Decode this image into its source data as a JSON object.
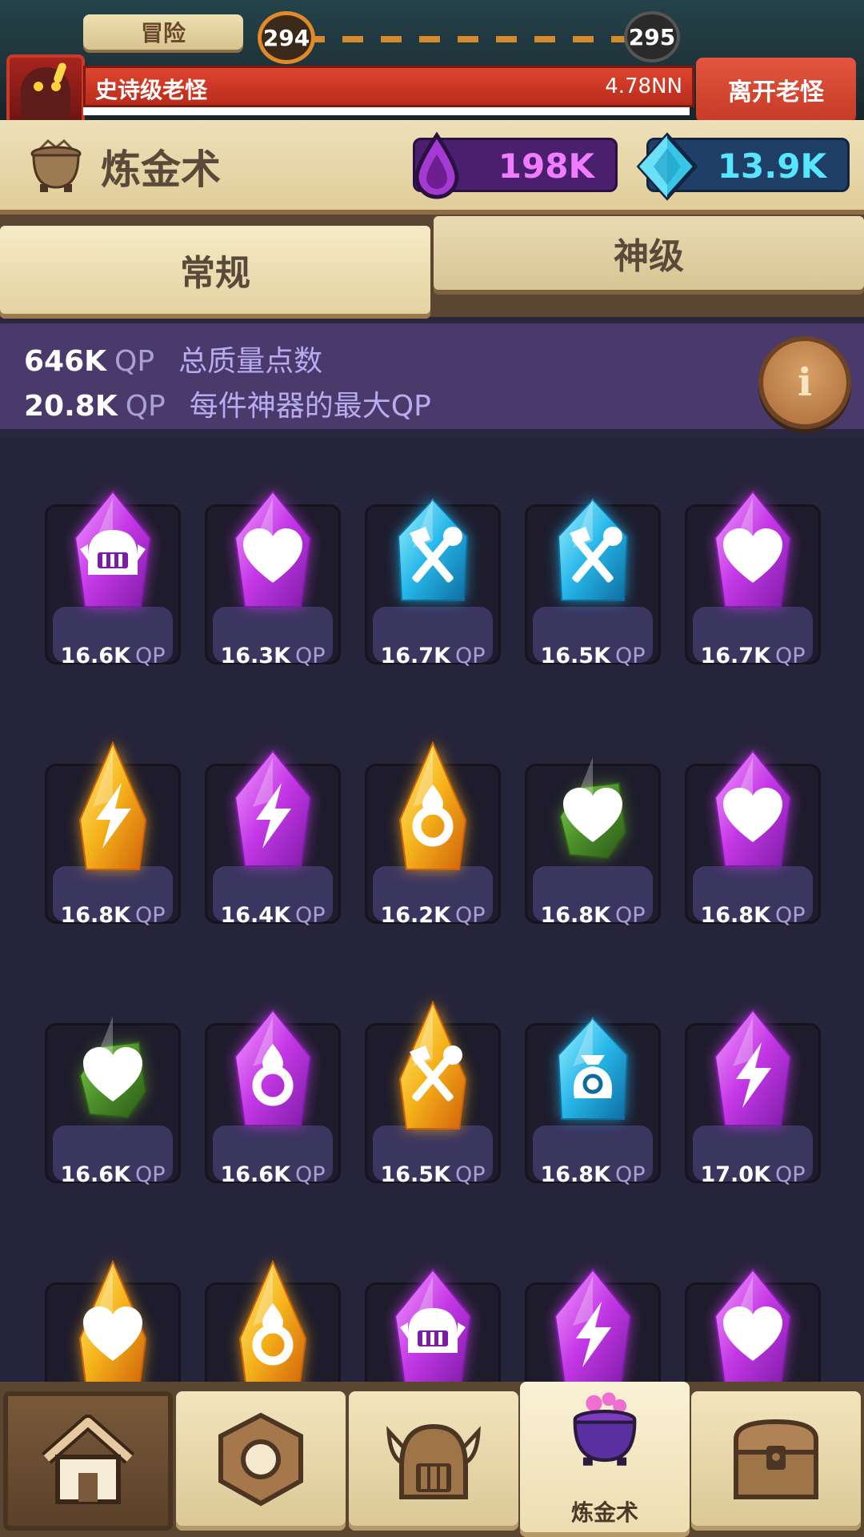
{
  "topbar": {
    "adventure_tab": "冒险",
    "stage_current": "294",
    "stage_next": "295",
    "boss_name": "史诗级老怪",
    "boss_hp": "4.78NN",
    "leave_button": "离开老怪"
  },
  "header": {
    "title": "炼金术",
    "currency_purple": "198K",
    "currency_blue": "13.9K"
  },
  "tabs": {
    "normal": "常规",
    "god": "神级"
  },
  "info": {
    "total_value": "646K",
    "total_unit": "QP",
    "total_label": "总质量点数",
    "max_value": "20.8K",
    "max_unit": "QP",
    "max_label": "每件神器的最大QP",
    "info_glyph": "i"
  },
  "qp_unit": "QP",
  "artifacts": [
    {
      "qp": "16.6K",
      "color": "purple",
      "icon": "helmet-icon"
    },
    {
      "qp": "16.3K",
      "color": "purple",
      "icon": "heart-icon"
    },
    {
      "qp": "16.7K",
      "color": "blue",
      "icon": "tools-icon"
    },
    {
      "qp": "16.5K",
      "color": "blue",
      "icon": "tools-icon"
    },
    {
      "qp": "16.7K",
      "color": "purple",
      "icon": "heart-icon"
    },
    {
      "qp": "16.8K",
      "color": "gold",
      "icon": "lightning-icon"
    },
    {
      "qp": "16.4K",
      "color": "purple",
      "icon": "lightning-icon"
    },
    {
      "qp": "16.2K",
      "color": "gold",
      "icon": "drop-ring-icon"
    },
    {
      "qp": "16.8K",
      "color": "green",
      "icon": "heart-icon"
    },
    {
      "qp": "16.8K",
      "color": "purple",
      "icon": "heart-icon"
    },
    {
      "qp": "16.6K",
      "color": "green",
      "icon": "heart-icon"
    },
    {
      "qp": "16.6K",
      "color": "purple",
      "icon": "drop-ring-icon"
    },
    {
      "qp": "16.5K",
      "color": "gold",
      "icon": "tools-icon"
    },
    {
      "qp": "16.8K",
      "color": "blue",
      "icon": "money-bag-icon"
    },
    {
      "qp": "17.0K",
      "color": "purple",
      "icon": "lightning-icon"
    },
    {
      "qp": "",
      "color": "gold",
      "icon": "heart-icon"
    },
    {
      "qp": "",
      "color": "gold",
      "icon": "drop-ring-icon"
    },
    {
      "qp": "",
      "color": "purple",
      "icon": "helmet-icon"
    },
    {
      "qp": "",
      "color": "purple",
      "icon": "lightning-icon"
    },
    {
      "qp": "",
      "color": "purple",
      "icon": "heart-icon"
    }
  ],
  "colors": {
    "purple": "#c437e6",
    "blue": "#27b6ea",
    "gold": "#f5b21a",
    "green": "#4c8f2a"
  },
  "nav": {
    "home_icon": "home-icon",
    "nut_icon": "nut-icon",
    "helmet_icon": "viking-helmet-icon",
    "alchemy_icon": "cauldron-icon",
    "alchemy_label": "炼金术",
    "chest_icon": "chest-icon"
  }
}
